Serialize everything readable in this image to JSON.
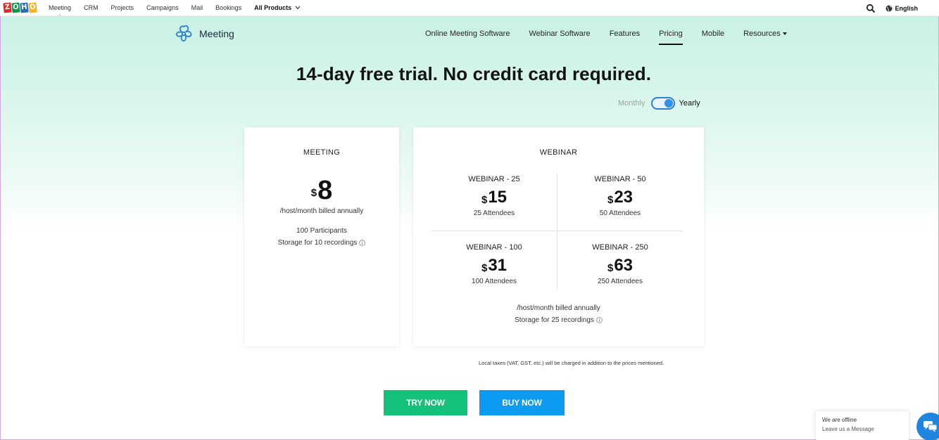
{
  "topbar": {
    "logo_letters": [
      "Z",
      "O",
      "H",
      "O"
    ],
    "logo_colors": [
      "#e42527",
      "#089949",
      "#226db4",
      "#f9b21d"
    ],
    "nav": [
      {
        "label": "Meeting",
        "active": true
      },
      {
        "label": "CRM"
      },
      {
        "label": "Projects"
      },
      {
        "label": "Campaigns"
      },
      {
        "label": "Mail"
      },
      {
        "label": "Bookings"
      },
      {
        "label": "All Products"
      }
    ],
    "language": "English"
  },
  "header": {
    "brand": "Meeting",
    "nav": [
      {
        "label": "Online Meeting Software"
      },
      {
        "label": "Webinar Software"
      },
      {
        "label": "Features"
      },
      {
        "label": "Pricing",
        "active": true
      },
      {
        "label": "Mobile"
      },
      {
        "label": "Resources"
      }
    ]
  },
  "headline": "14-day free trial. No credit card required.",
  "billing": {
    "monthly": "Monthly",
    "yearly": "Yearly",
    "selected": "Yearly"
  },
  "meeting_card": {
    "title": "MEETING",
    "currency": "$",
    "price": "8",
    "billing_note": "/host/month billed annually",
    "features": [
      "100 Participants",
      "Storage for 10 recordings"
    ]
  },
  "webinar_card": {
    "title": "WEBINAR",
    "currency": "$",
    "plans": [
      {
        "name": "WEBINAR - 25",
        "price": "15",
        "attendees": "25 Attendees"
      },
      {
        "name": "WEBINAR - 50",
        "price": "23",
        "attendees": "50 Attendees"
      },
      {
        "name": "WEBINAR - 100",
        "price": "31",
        "attendees": "100 Attendees"
      },
      {
        "name": "WEBINAR - 250",
        "price": "63",
        "attendees": "250 Attendees"
      }
    ],
    "billing_note": "/host/month billed annually",
    "storage": "Storage for 25 recordings"
  },
  "tax_note": "Local taxes (VAT, GST, etc.) will be charged in addition to the prices mentioned.",
  "buttons": {
    "try": "TRY NOW",
    "buy": "BUY NOW"
  },
  "chat": {
    "status": "We are offline",
    "action": "Leave us a Message"
  },
  "colors": {
    "accent_green": "#14c17a",
    "accent_blue": "#0c9bf0",
    "chat_blue": "#1e86e0"
  }
}
